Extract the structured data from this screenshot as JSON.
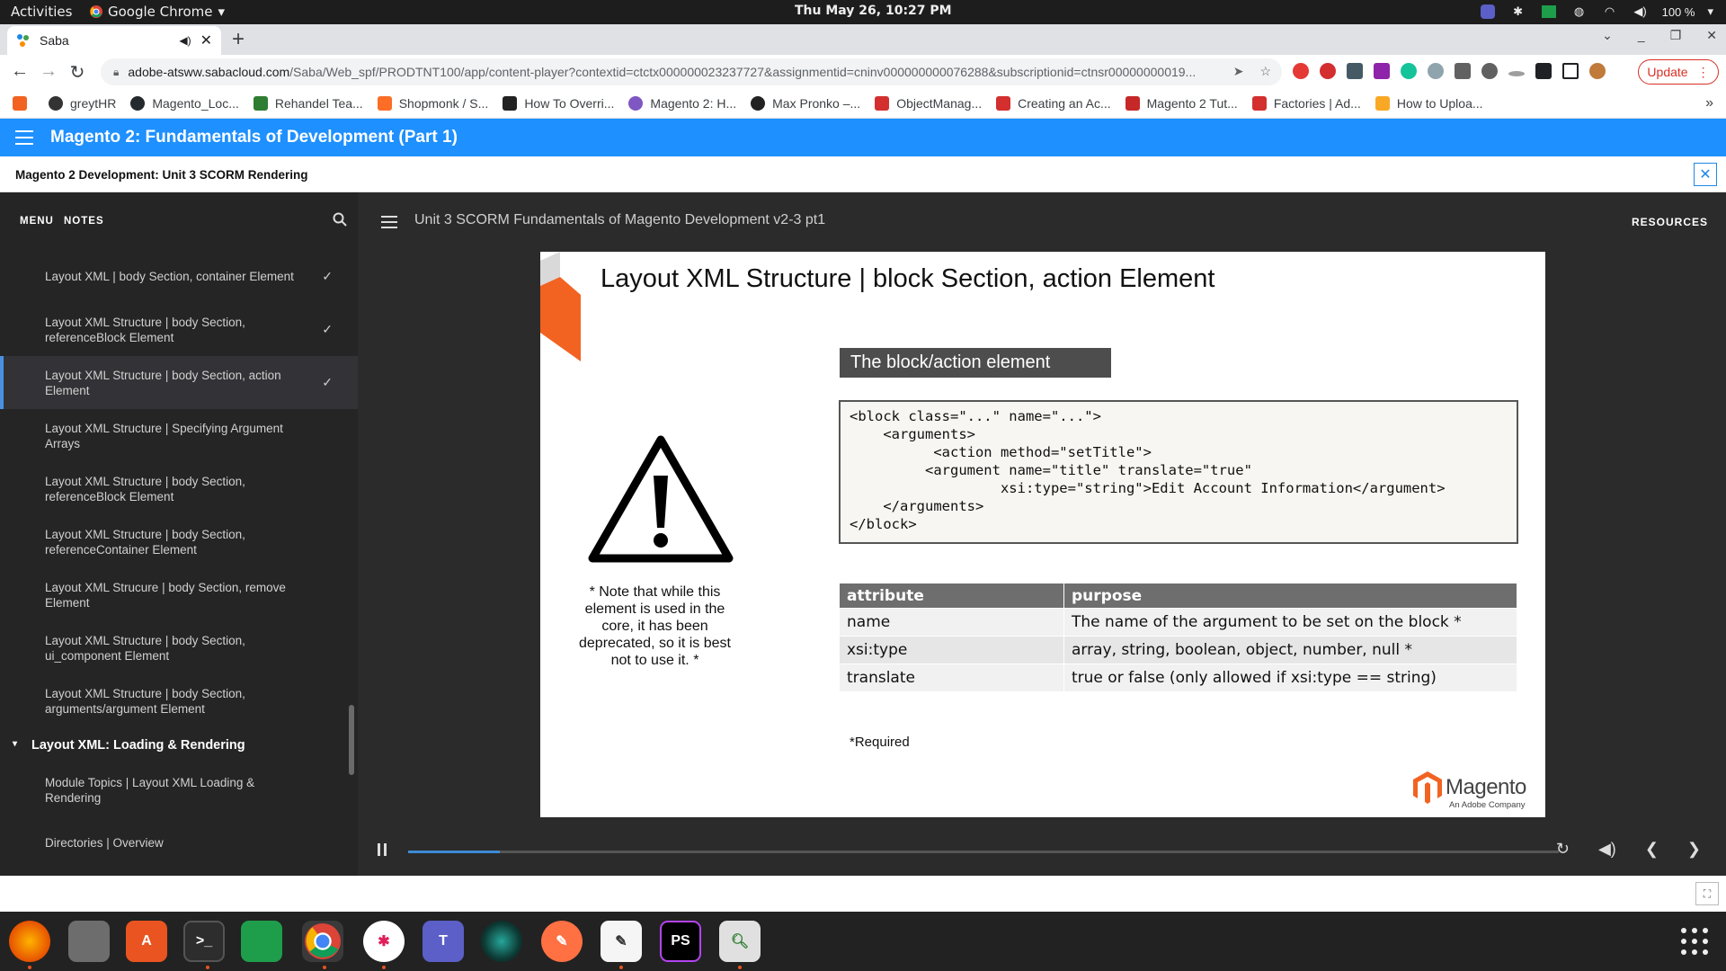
{
  "system": {
    "activities": "Activities",
    "app_name": "Google Chrome",
    "clock": "Thu May 26, 10:27 PM",
    "battery": "100 %"
  },
  "browser": {
    "tab_title": "Saba",
    "url_host": "adobe-atsww.sabacloud.com",
    "url_path": "/Saba/Web_spf/PRODTNT100/app/content-player?contextid=ctctx000000023237727&assignmentid=cninv000000000076288&subscriptionid=ctnsr00000000019...",
    "update_label": "Update",
    "bookmarks": [
      "greytHR",
      "Magento_Loc...",
      "Rehandel Tea...",
      "Shopmonk / S...",
      "How To Overri...",
      "Magento 2: H...",
      "Max Pronko –...",
      "ObjectManag...",
      "Creating an Ac...",
      "Magento 2 Tut...",
      "Factories | Ad...",
      "How to Uploa..."
    ]
  },
  "course": {
    "title": "Magento 2: Fundamentals of Development (Part 1)",
    "subtitle": "Magento 2 Development: Unit 3 SCORM Rendering"
  },
  "sidebar": {
    "tabs": [
      "MENU",
      "NOTES"
    ],
    "items": [
      {
        "label": "Layout XML | body Section, container Element",
        "done": true
      },
      {
        "label": "Layout XML Structure | body Section, referenceBlock Element",
        "done": true
      },
      {
        "label": "Layout XML Structure | body Section, action Element",
        "done": true,
        "active": true
      },
      {
        "label": "Layout XML Structure | Specifying Argument Arrays",
        "done": false
      },
      {
        "label": "Layout XML Structure | body Section, referenceBlock Element",
        "done": false
      },
      {
        "label": "Layout XML Structure | body Section, referenceContainer Element",
        "done": false
      },
      {
        "label": "Layout XML Strucure | body Section, remove Element",
        "done": false
      },
      {
        "label": "Layout XML Structure | body Section, ui_component Element",
        "done": false
      },
      {
        "label": "Layout XML Structure | body Section, arguments/argument Element",
        "done": false
      }
    ],
    "section": "Layout XML: Loading & Rendering",
    "section_items": [
      {
        "label": "Module Topics | Layout XML Loading & Rendering"
      },
      {
        "label": "Directories | Overview"
      }
    ]
  },
  "player": {
    "title": "Unit 3 SCORM Fundamentals of Magento Development v2-3 pt1",
    "resources": "RESOURCES",
    "progress": 0.08
  },
  "slide": {
    "title": "Layout XML Structure | block Section, action Element",
    "section_label": "The block/action element",
    "code": "<block class=\"...\" name=\"...\">\n    <arguments>\n          <action method=\"setTitle\">\n         <argument name=\"title\" translate=\"true\"\n                  xsi:type=\"string\">Edit Account Information</argument>\n    </arguments>\n</block>",
    "note": "* Note that while this element is used in the core, it has been deprecated, so it is best not to use it. *",
    "table": {
      "headers": [
        "attribute",
        "purpose"
      ],
      "rows": [
        [
          "name",
          "The name of the argument to be set on the block *"
        ],
        [
          "xsi:type",
          "array, string, boolean, object, number, null *"
        ],
        [
          "translate",
          "true or false (only allowed if xsi:type == string)"
        ]
      ]
    },
    "required": "*Required",
    "logo_word": "Magento",
    "logo_sub": "An Adobe Company"
  }
}
